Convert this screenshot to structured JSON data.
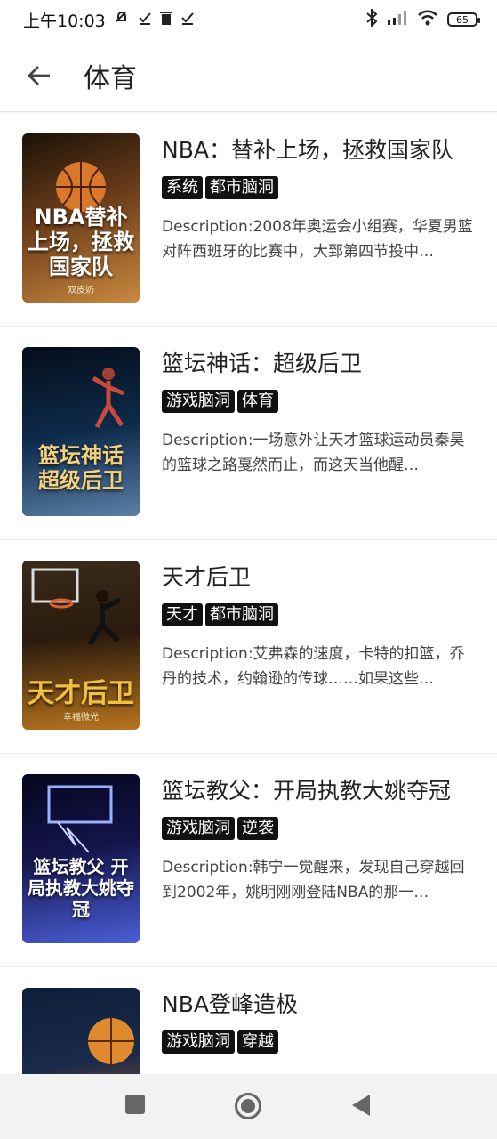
{
  "status_bar": {
    "time": "上午10:03",
    "battery": "65"
  },
  "app_bar": {
    "title": "体育"
  },
  "books": [
    {
      "title": "NBA：替补上场，拯救国家队",
      "tags": [
        "系统",
        "都市脑洞"
      ],
      "description": "Description:2008年奥运会小组赛，华夏男篮对阵西班牙的比赛中，大郅第四节投中…",
      "cover_text": "NBA替补上场，拯救国家队",
      "cover_sub": "双皮奶",
      "cover_colors": [
        "#6b3c1a",
        "#c9893f"
      ]
    },
    {
      "title": "篮坛神话：超级后卫",
      "tags": [
        "游戏脑洞",
        "体育"
      ],
      "description": "Description:一场意外让天才篮球运动员秦昊的篮球之路戛然而止，而这天当他醒…",
      "cover_text": "篮坛神话 超级后卫",
      "cover_sub": "",
      "cover_colors": [
        "#0d2a4a",
        "#5b7fa6"
      ]
    },
    {
      "title": "天才后卫",
      "tags": [
        "天才",
        "都市脑洞"
      ],
      "description": "Description:艾弗森的速度，卡特的扣篮，乔丹的技术，约翰逊的传球……如果这些…",
      "cover_text": "天才后卫",
      "cover_sub": "幸福微光",
      "cover_colors": [
        "#2a1a0d",
        "#b8741e"
      ]
    },
    {
      "title": "篮坛教父：开局执教大姚夺冠",
      "tags": [
        "游戏脑洞",
        "逆袭"
      ],
      "description": "Description:韩宁一觉醒来，发现自己穿越回到2002年，姚明刚刚登陆NBA的那一…",
      "cover_text": "篮坛教父 开局执教大姚夺冠",
      "cover_sub": "",
      "cover_colors": [
        "#14144a",
        "#4a5fd6"
      ]
    },
    {
      "title": "NBA登峰造极",
      "tags": [
        "游戏脑洞",
        "穿越"
      ],
      "description": "",
      "cover_text": "",
      "cover_sub": "",
      "cover_colors": [
        "#0c1e3a",
        "#d8682a"
      ]
    }
  ]
}
